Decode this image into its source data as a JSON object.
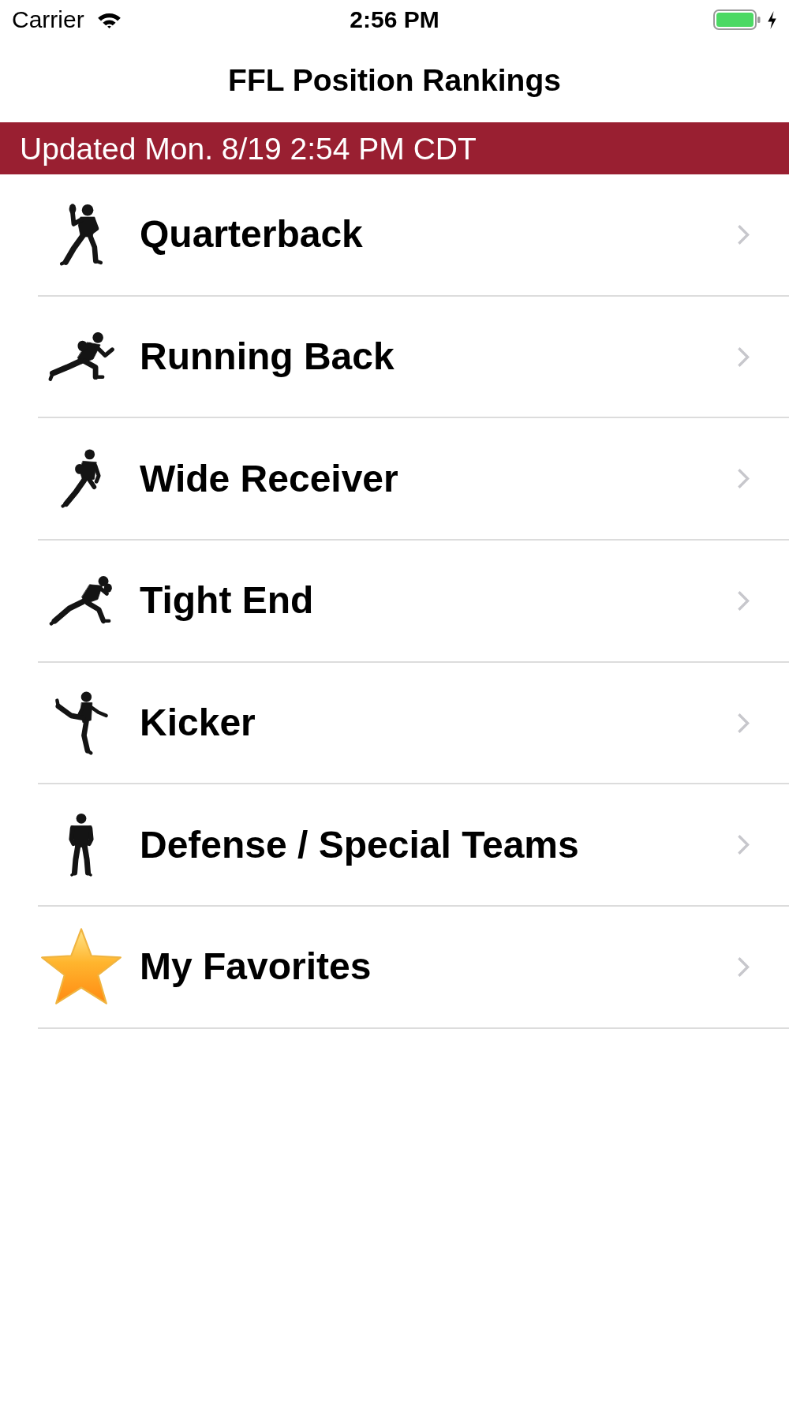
{
  "status_bar": {
    "carrier": "Carrier",
    "time": "2:56 PM"
  },
  "navigation_bar": {
    "title": "FFL Position Rankings"
  },
  "update_banner": {
    "text": "Updated Mon. 8/19 2:54 PM CDT"
  },
  "positions": [
    {
      "label": "Quarterback",
      "kind": "passer"
    },
    {
      "label": "Running Back",
      "kind": "runner"
    },
    {
      "label": "Wide Receiver",
      "kind": "receiver"
    },
    {
      "label": "Tight End",
      "kind": "sprinter"
    },
    {
      "label": "Kicker",
      "kind": "kicker"
    },
    {
      "label": "Defense / Special Teams",
      "kind": "stander"
    },
    {
      "label": "My Favorites",
      "kind": "star"
    }
  ]
}
